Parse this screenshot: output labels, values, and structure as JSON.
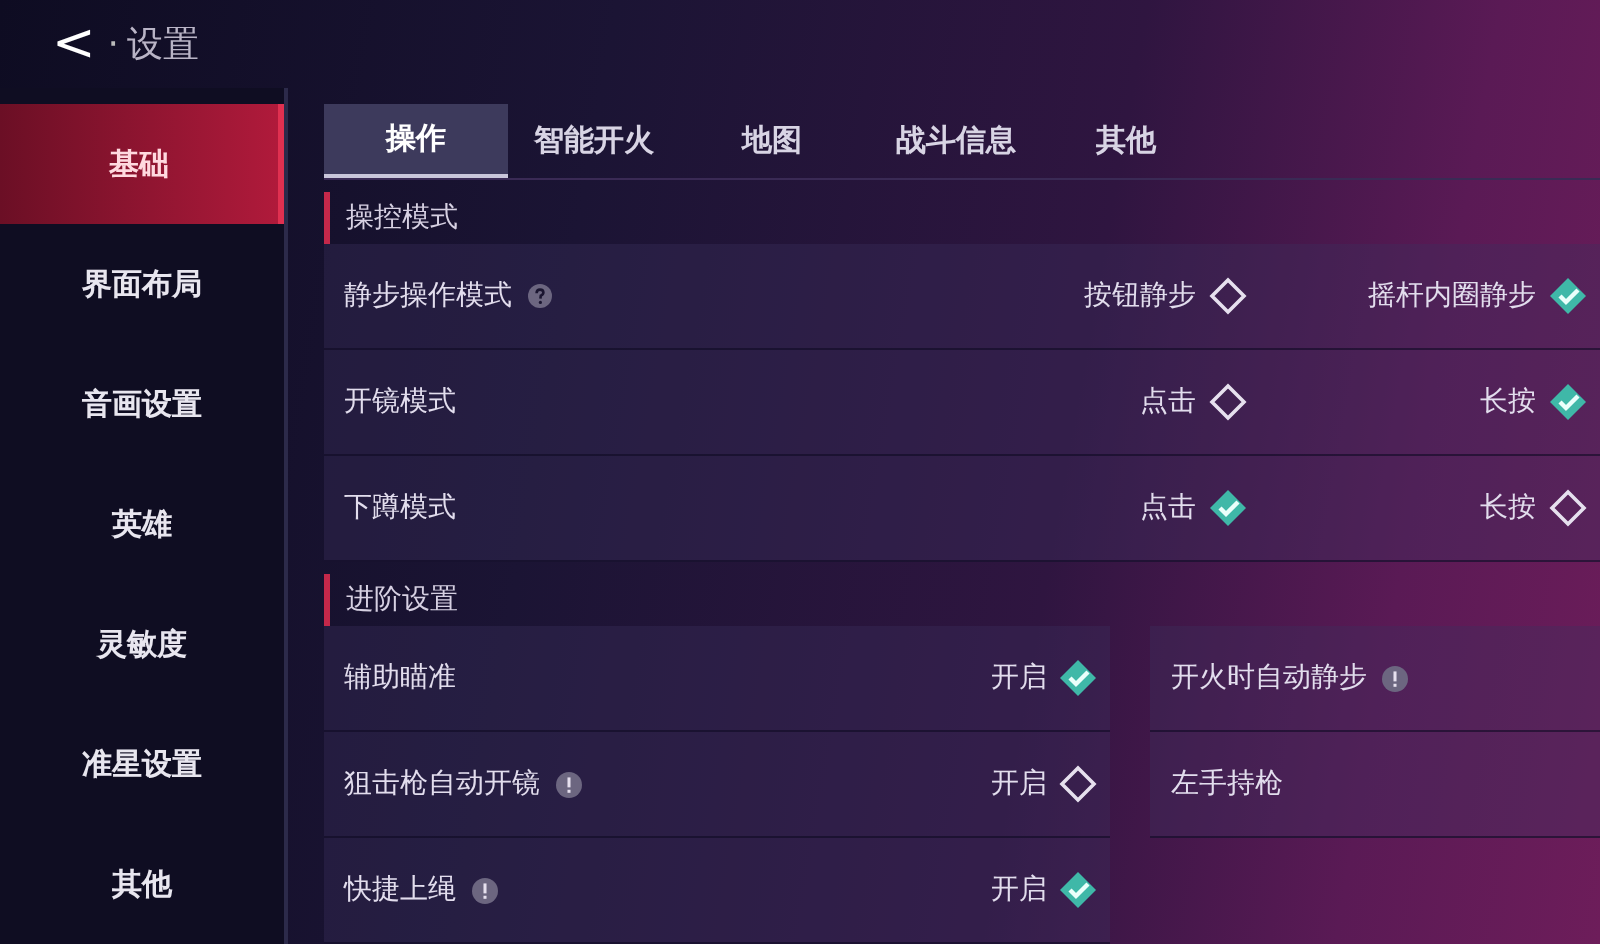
{
  "header": {
    "back": "<",
    "separator": "·",
    "title": "设置"
  },
  "sidebar": {
    "items": [
      {
        "label": "基础",
        "selected": true
      },
      {
        "label": "界面布局",
        "selected": false
      },
      {
        "label": "音画设置",
        "selected": false
      },
      {
        "label": "英雄",
        "selected": false
      },
      {
        "label": "灵敏度",
        "selected": false
      },
      {
        "label": "准星设置",
        "selected": false
      },
      {
        "label": "其他",
        "selected": false
      }
    ]
  },
  "tabs": [
    {
      "label": "操作",
      "selected": true
    },
    {
      "label": "智能开火",
      "selected": false
    },
    {
      "label": "地图",
      "selected": false
    },
    {
      "label": "战斗信息",
      "selected": false
    },
    {
      "label": "其他",
      "selected": false
    }
  ],
  "sections": [
    {
      "title": "操控模式",
      "kind": "choice",
      "rows": [
        {
          "label": "静步操作模式",
          "kind": "help",
          "options": [
            {
              "label": "按钮静步",
              "selected": false
            },
            {
              "label": "摇杆内圈静步",
              "selected": true
            }
          ]
        },
        {
          "label": "开镜模式",
          "kind": "plain",
          "options": [
            {
              "label": "点击",
              "selected": false
            },
            {
              "label": "长按",
              "selected": true
            }
          ]
        },
        {
          "label": "下蹲模式",
          "kind": "plain",
          "options": [
            {
              "label": "点击",
              "selected": true
            },
            {
              "label": "长按",
              "selected": false
            }
          ]
        }
      ]
    },
    {
      "title": "进阶设置",
      "kind": "toggles",
      "columns": [
        [
          {
            "label": "辅助瞄准",
            "kind": "plain",
            "value": "开启",
            "checked": true
          },
          {
            "label": "狙击枪自动开镜",
            "kind": "info",
            "value": "开启",
            "checked": false
          },
          {
            "label": "快捷上绳",
            "kind": "info",
            "value": "开启",
            "checked": true
          }
        ],
        [
          {
            "label": "开火时自动静步",
            "kind": "info"
          },
          {
            "label": "左手持枪",
            "kind": "plain"
          }
        ]
      ]
    }
  ]
}
